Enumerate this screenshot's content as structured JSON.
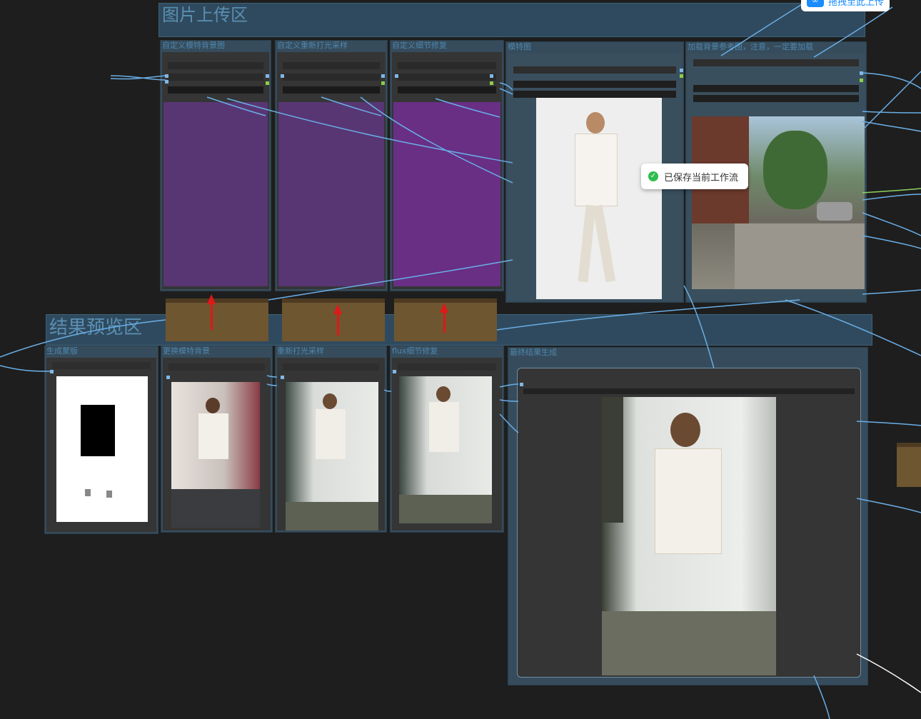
{
  "groups": {
    "upload": {
      "title": "图片上传区"
    },
    "preview": {
      "title": "结果预览区"
    }
  },
  "upload_nodes": [
    {
      "title": "自定义模特背景图"
    },
    {
      "title": "自定义重新打光采样"
    },
    {
      "title": "自定义细节修复"
    },
    {
      "title": "模特图"
    },
    {
      "title": "加载背景参考图，注意，一定要加载"
    }
  ],
  "preview_nodes": [
    {
      "title": "生成蒙版"
    },
    {
      "title": "更换模特背景"
    },
    {
      "title": "重新打光采样"
    },
    {
      "title": "flux细节修复"
    },
    {
      "title": "最终结果生成"
    }
  ],
  "toast": {
    "text": "已保存当前工作流"
  },
  "top_button": {
    "label": "拖拽至此上传"
  },
  "colors": {
    "canvas": "#1e1e1e",
    "group": "#2f4a5e",
    "node": "#364c5c",
    "bypass": "#6b2f8a",
    "wire": "#6aaee6",
    "annotation_arrow": "#e01818"
  }
}
